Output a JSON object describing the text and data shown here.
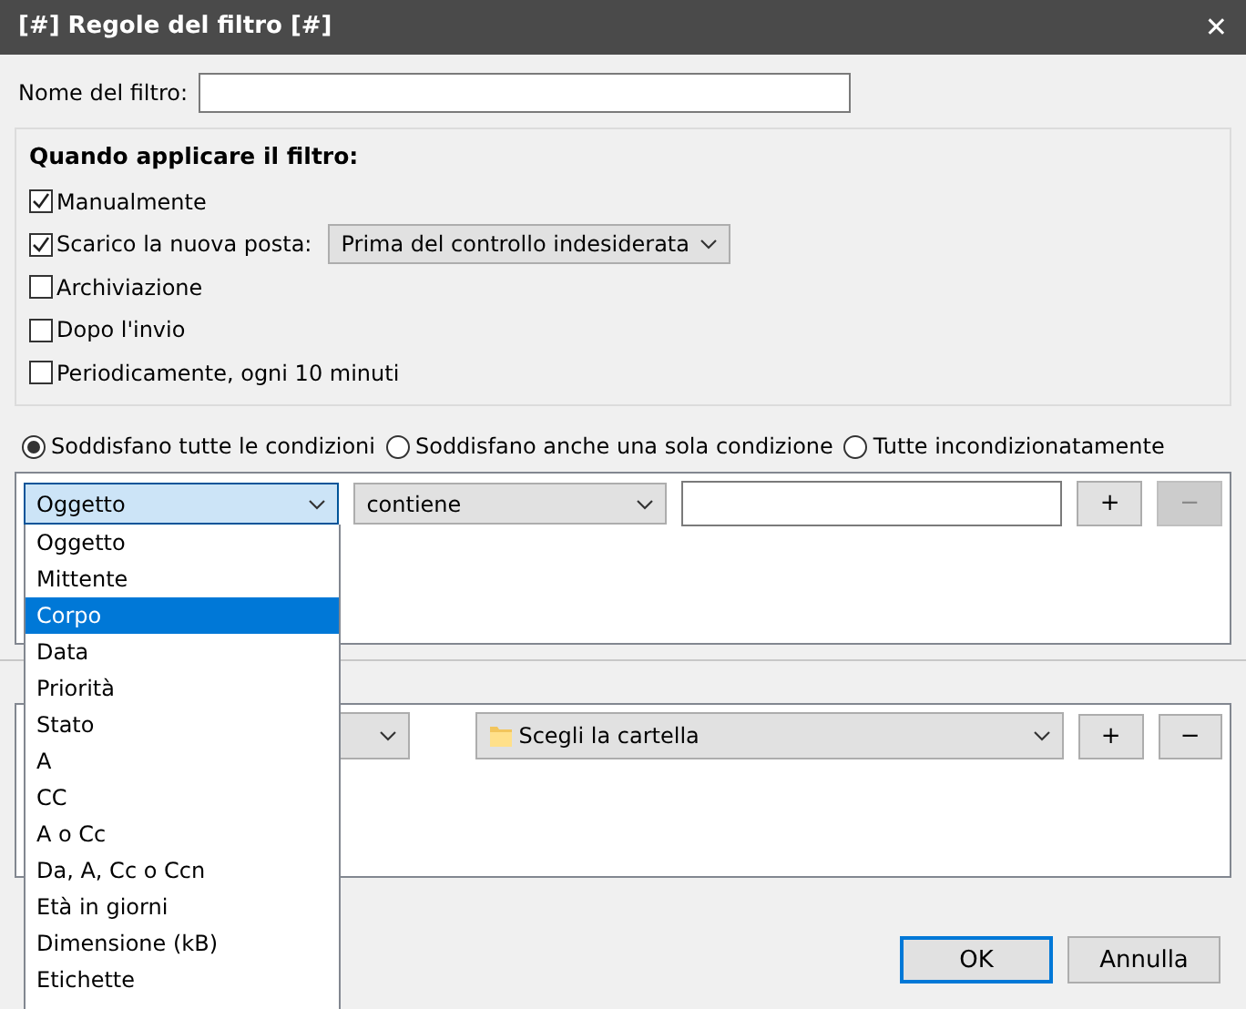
{
  "window": {
    "title": "[#] Regole del filtro [#]",
    "close": "✕"
  },
  "filter_name": {
    "label": "Nome del filtro:"
  },
  "when": {
    "title": "Quando applicare il filtro:",
    "options": [
      {
        "label": "Manualmente",
        "checked": true
      },
      {
        "label": "Scarico la nuova posta:",
        "checked": true,
        "select": "Prima del controllo indesiderata"
      },
      {
        "label": "Archiviazione",
        "checked": false
      },
      {
        "label": "Dopo l'invio",
        "checked": false
      },
      {
        "label": "Periodicamente, ogni 10 minuti",
        "checked": false
      }
    ]
  },
  "match": [
    {
      "label": "Soddisfano tutte le condizioni",
      "selected": true
    },
    {
      "label": "Soddisfano anche una sola condizione",
      "selected": false
    },
    {
      "label": "Tutte incondizionatamente",
      "selected": false
    }
  ],
  "condition": {
    "field": "Oggetto",
    "operator": "contiene",
    "add": "+",
    "remove": "−",
    "remove_disabled": true
  },
  "action": {
    "folder": "Scegli la cartella",
    "add": "+",
    "remove": "−"
  },
  "dropdown": [
    {
      "label": "Oggetto",
      "selected": false
    },
    {
      "label": "Mittente",
      "selected": false
    },
    {
      "label": "Corpo",
      "selected": true
    },
    {
      "label": "Data",
      "selected": false
    },
    {
      "label": "Priorità",
      "selected": false
    },
    {
      "label": "Stato",
      "selected": false
    },
    {
      "label": "A",
      "selected": false
    },
    {
      "label": "CC",
      "selected": false
    },
    {
      "label": "A o Cc",
      "selected": false
    },
    {
      "label": "Da, A, Cc o Ccn",
      "selected": false
    },
    {
      "label": "Età in giorni",
      "selected": false
    },
    {
      "label": "Dimensione (kB)",
      "selected": false
    },
    {
      "label": "Etichette",
      "selected": false
    }
  ],
  "buttons": [
    {
      "label": "OK",
      "default": true
    },
    {
      "label": "Annulla",
      "default": false
    }
  ]
}
